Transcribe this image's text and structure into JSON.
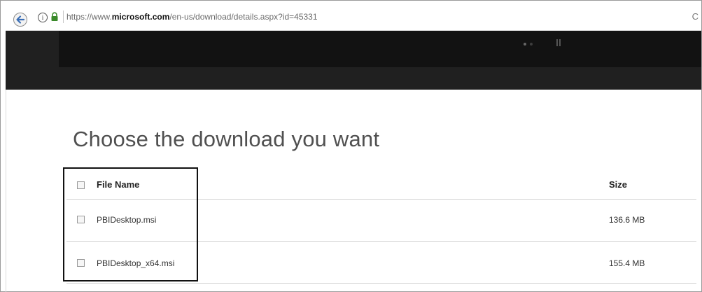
{
  "browser": {
    "url_prefix": "https://www.",
    "url_domain": "microsoft.com",
    "url_path": "/en-us/download/details.aspx?id=45331",
    "right_glyph": "C"
  },
  "page": {
    "title": "Choose the download you want"
  },
  "table": {
    "headers": {
      "file_name": "File Name",
      "size": "Size"
    },
    "rows": [
      {
        "name": "PBIDesktop.msi",
        "size": "136.6 MB"
      },
      {
        "name": "PBIDesktop_x64.msi",
        "size": "155.4 MB"
      }
    ]
  }
}
